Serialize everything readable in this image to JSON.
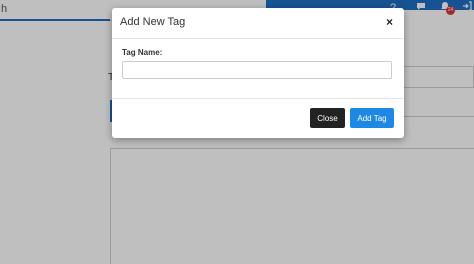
{
  "background": {
    "search_fragment": "h",
    "label_fragment": "T",
    "icons": {
      "help": "?",
      "chat": "chat-bubble-icon",
      "bell": "bell-icon",
      "exit": "exit-icon"
    },
    "notification_count": "24",
    "colors": {
      "topbar_blue": "#1f6fc4",
      "badge_red": "#d9363e"
    }
  },
  "modal": {
    "title": "Add New Tag",
    "close_icon": "×",
    "field": {
      "label": "Tag Name:",
      "value": "",
      "placeholder": ""
    },
    "buttons": {
      "close_label": "Close",
      "add_label": "Add Tag"
    },
    "colors": {
      "close_button": "#222222",
      "add_button": "#1e88e5"
    }
  }
}
